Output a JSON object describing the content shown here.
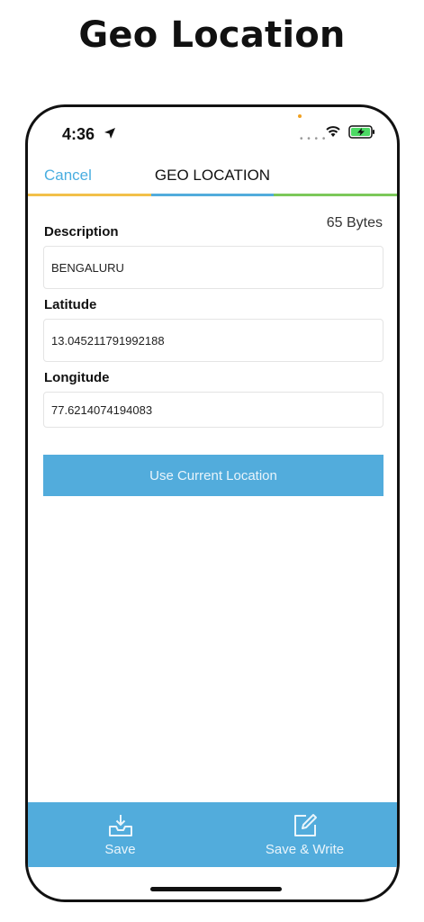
{
  "promo": {
    "title": "Geo Location"
  },
  "status_bar": {
    "time": "4:36"
  },
  "nav": {
    "cancel_label": "Cancel",
    "title": "GEO LOCATION",
    "underline_colors": [
      "#f2c04a",
      "#52acdc",
      "#7cc85a"
    ]
  },
  "form": {
    "bytes": "65 Bytes",
    "description": {
      "label": "Description",
      "value": "BENGALURU"
    },
    "latitude": {
      "label": "Latitude",
      "value": "13.045211791992188"
    },
    "longitude": {
      "label": "Longitude",
      "value": "77.6214074194083"
    },
    "use_location_label": "Use Current Location"
  },
  "toolbar": {
    "save_label": "Save",
    "save_write_label": "Save & Write"
  },
  "colors": {
    "accent": "#52acdc",
    "link": "#4aaee0"
  },
  "icons": {
    "location": "location-arrow-icon",
    "wifi": "wifi-icon",
    "battery": "battery-charging-icon",
    "save": "inbox-download-icon",
    "save_write": "edit-square-icon"
  }
}
